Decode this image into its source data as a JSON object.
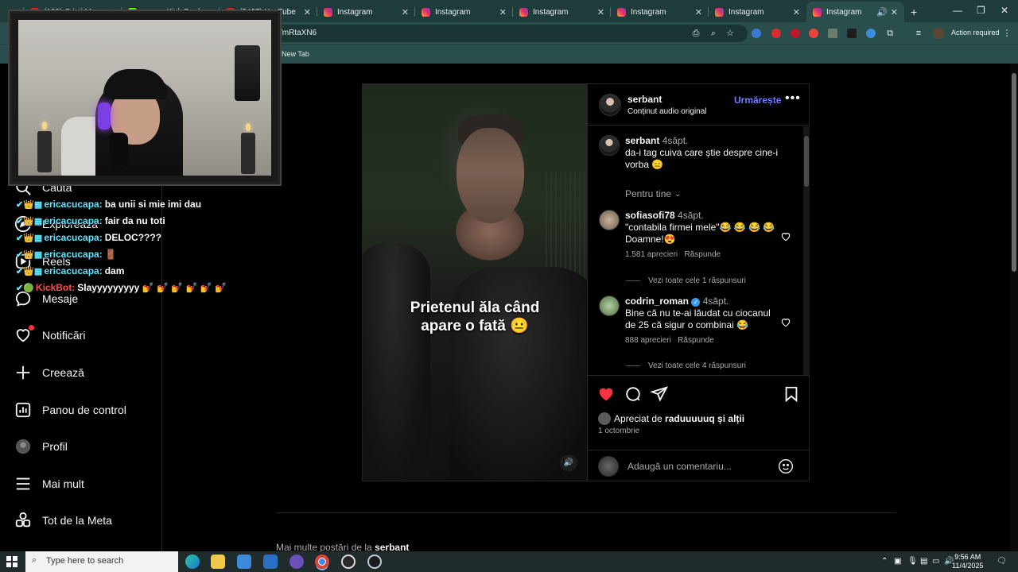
{
  "browser": {
    "tabs": [
      {
        "title": "(109) Cristi Mec...",
        "favicon": "youtube"
      },
      {
        "title": "gram - Kick Dashb...",
        "favicon": "kick"
      },
      {
        "title": "(5427) YouTube",
        "favicon": "youtube"
      },
      {
        "title": "Instagram",
        "favicon": "instagram"
      },
      {
        "title": "Instagram",
        "favicon": "instagram"
      },
      {
        "title": "Instagram",
        "favicon": "instagram"
      },
      {
        "title": "Instagram",
        "favicon": "instagram"
      },
      {
        "title": "Instagram",
        "favicon": "instagram"
      },
      {
        "title": "Instagram",
        "favicon": "instagram",
        "active": true
      }
    ],
    "address": "/mRtaXN6",
    "action_required": "Action required",
    "bookmark_new_tab": "New Tab"
  },
  "sidebar": {
    "items": [
      {
        "label": "Caută",
        "icon": "search-icon"
      },
      {
        "label": "Explorează",
        "icon": "compass-icon"
      },
      {
        "label": "Reels",
        "icon": "reels-icon"
      },
      {
        "label": "Mesaje",
        "icon": "messenger-icon"
      },
      {
        "label": "Notificări",
        "icon": "heart-icon"
      },
      {
        "label": "Creează",
        "icon": "plus-icon"
      },
      {
        "label": "Panou de control",
        "icon": "dashboard-icon"
      },
      {
        "label": "Profil",
        "icon": "avatar-icon"
      },
      {
        "label": "Mai mult",
        "icon": "menu-icon"
      },
      {
        "label": "Tot de la Meta",
        "icon": "meta-icon"
      }
    ]
  },
  "post": {
    "author": "serbant",
    "audio": "Conținut audio original",
    "follow_label": "Urmărește",
    "video_caption": "Prietenul ăla când apare o fată 😐",
    "caption_comment": {
      "user": "serbant",
      "time": "4săpt.",
      "text": "da-i tag cuiva care știe despre cine-i vorba 😑"
    },
    "sort_label": "Pentru tine",
    "comments": [
      {
        "user": "sofiasofi78",
        "time": "4săpt.",
        "text": "\"contabila firmei mele\"😂 😂 😂 😂 Doamne!😍",
        "likes": "1.581 aprecieri",
        "reply": "Răspunde",
        "view_replies": "Vezi toate cele 1 răspunsuri"
      },
      {
        "user": "codrin_roman",
        "verified": true,
        "time": "4săpt.",
        "text": "Bine că nu te-ai lăudat cu ciocanul de 25 că sigur o combinai 😂",
        "likes": "888 aprecieri",
        "reply": "Răspunde",
        "view_replies": "Vezi toate cele 4 răspunsuri"
      }
    ],
    "liked_by_prefix": "Apreciat de",
    "liked_by_user": "raduuuuuq",
    "liked_by_suffix": "și alții",
    "date": "1 octombrie",
    "add_comment_placeholder": "Adaugă un comentariu...",
    "liked": true
  },
  "more_posts": {
    "prefix": "Mai multe postări de la",
    "user": "serbant"
  },
  "chat": [
    {
      "user": "ericacucapa:",
      "msg": "ba unii si mie imi dau",
      "color": "#5ee8ff"
    },
    {
      "user": "ericacucapa:",
      "msg": "fair da nu toti",
      "color": "#5ee8ff"
    },
    {
      "user": "ericacucapa:",
      "msg": "DELOC????",
      "color": "#5ee8ff"
    },
    {
      "user": "ericacucapa:",
      "msg": "🚪",
      "color": "#5ee8ff"
    },
    {
      "user": "ericacucapa:",
      "msg": "dam",
      "color": "#5ee8ff"
    },
    {
      "user": "KickBot:",
      "msg": "Slayyyyyyyyy 💅 💅 💅 💅 💅 💅",
      "color": "#ff4b4b"
    }
  ],
  "taskbar": {
    "search_placeholder": "Type here to search",
    "time": "9:56 AM",
    "date": "11/4/2025"
  },
  "colors": {
    "accent": "#6a7dff",
    "like": "#ff3040",
    "browser_frame": "#294e4c"
  }
}
